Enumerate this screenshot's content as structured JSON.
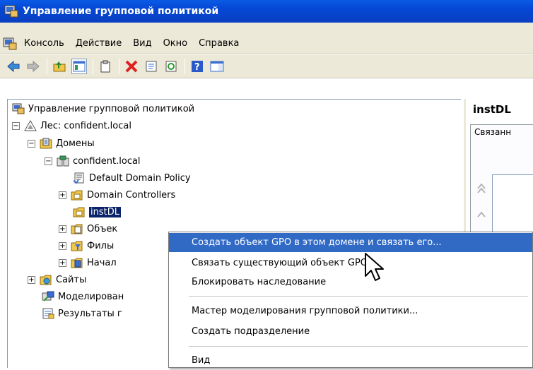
{
  "window": {
    "title": "Управление групповой политикой"
  },
  "menubar": {
    "items": [
      "Консоль",
      "Действие",
      "Вид",
      "Окно",
      "Справка"
    ]
  },
  "tree": {
    "root": "Управление групповой политикой",
    "forest": "Лес: confident.local",
    "domains": "Домены",
    "domain": "confident.local",
    "default_policy": "Default Domain Policy",
    "dcs": "Domain Controllers",
    "instdl": "instDL",
    "objects": "Объек",
    "filters": "Филы",
    "starters": "Начал",
    "sites": "Сайты",
    "modeling": "Моделирован",
    "results": "Результаты г"
  },
  "right_pane": {
    "title": "instDL",
    "tab": "Связанн"
  },
  "context_menu": {
    "items": [
      "Создать объект GPO в этом домене и связать его...",
      "Связать существующий объект GPO...",
      "Блокировать наследование",
      "Мастер моделирования групповой политики...",
      "Создать подразделение",
      "Вид"
    ]
  }
}
